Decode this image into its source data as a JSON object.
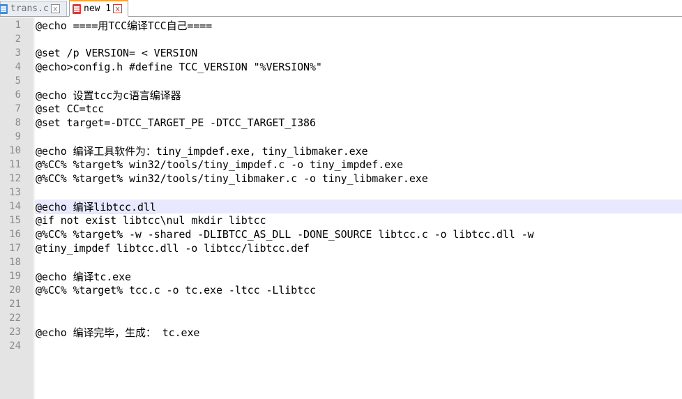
{
  "tabs": [
    {
      "label": "trans.c",
      "active": false,
      "icon": "document-icon",
      "close": "x"
    },
    {
      "label": "new 1",
      "active": true,
      "icon": "unsaved-document-icon",
      "close": "x"
    }
  ],
  "editor": {
    "current_line": 14,
    "lines": [
      {
        "num": "1",
        "text": "@echo ====用TCC编译TCC自己===="
      },
      {
        "num": "2",
        "text": ""
      },
      {
        "num": "3",
        "text": "@set /p VERSION= < VERSION"
      },
      {
        "num": "4",
        "text": "@echo>config.h #define TCC_VERSION \"%VERSION%\""
      },
      {
        "num": "5",
        "text": ""
      },
      {
        "num": "6",
        "text": "@echo 设置tcc为c语言编译器"
      },
      {
        "num": "7",
        "text": "@set CC=tcc"
      },
      {
        "num": "8",
        "text": "@set target=-DTCC_TARGET_PE -DTCC_TARGET_I386"
      },
      {
        "num": "9",
        "text": ""
      },
      {
        "num": "10",
        "text": "@echo 编译工具软件为：tiny_impdef.exe, tiny_libmaker.exe"
      },
      {
        "num": "11",
        "text": "@%CC% %target% win32/tools/tiny_impdef.c -o tiny_impdef.exe"
      },
      {
        "num": "12",
        "text": "@%CC% %target% win32/tools/tiny_libmaker.c -o tiny_libmaker.exe"
      },
      {
        "num": "13",
        "text": ""
      },
      {
        "num": "14",
        "text": "@echo 编译libtcc.dll"
      },
      {
        "num": "15",
        "text": "@if not exist libtcc\\nul mkdir libtcc"
      },
      {
        "num": "16",
        "text": "@%CC% %target% -w -shared -DLIBTCC_AS_DLL -DONE_SOURCE libtcc.c -o libtcc.dll -w"
      },
      {
        "num": "17",
        "text": "@tiny_impdef libtcc.dll -o libtcc/libtcc.def"
      },
      {
        "num": "18",
        "text": ""
      },
      {
        "num": "19",
        "text": "@echo 编译tc.exe"
      },
      {
        "num": "20",
        "text": "@%CC% %target% tcc.c -o tc.exe -ltcc -Llibtcc"
      },
      {
        "num": "21",
        "text": ""
      },
      {
        "num": "22",
        "text": ""
      },
      {
        "num": "23",
        "text": "@echo 编译完毕，生成： tc.exe"
      },
      {
        "num": "24",
        "text": ""
      }
    ]
  },
  "colors": {
    "current_line_highlight": "#e8e8ff",
    "gutter": "#e4e4e4",
    "active_tab_accent": "#f3a53a"
  }
}
